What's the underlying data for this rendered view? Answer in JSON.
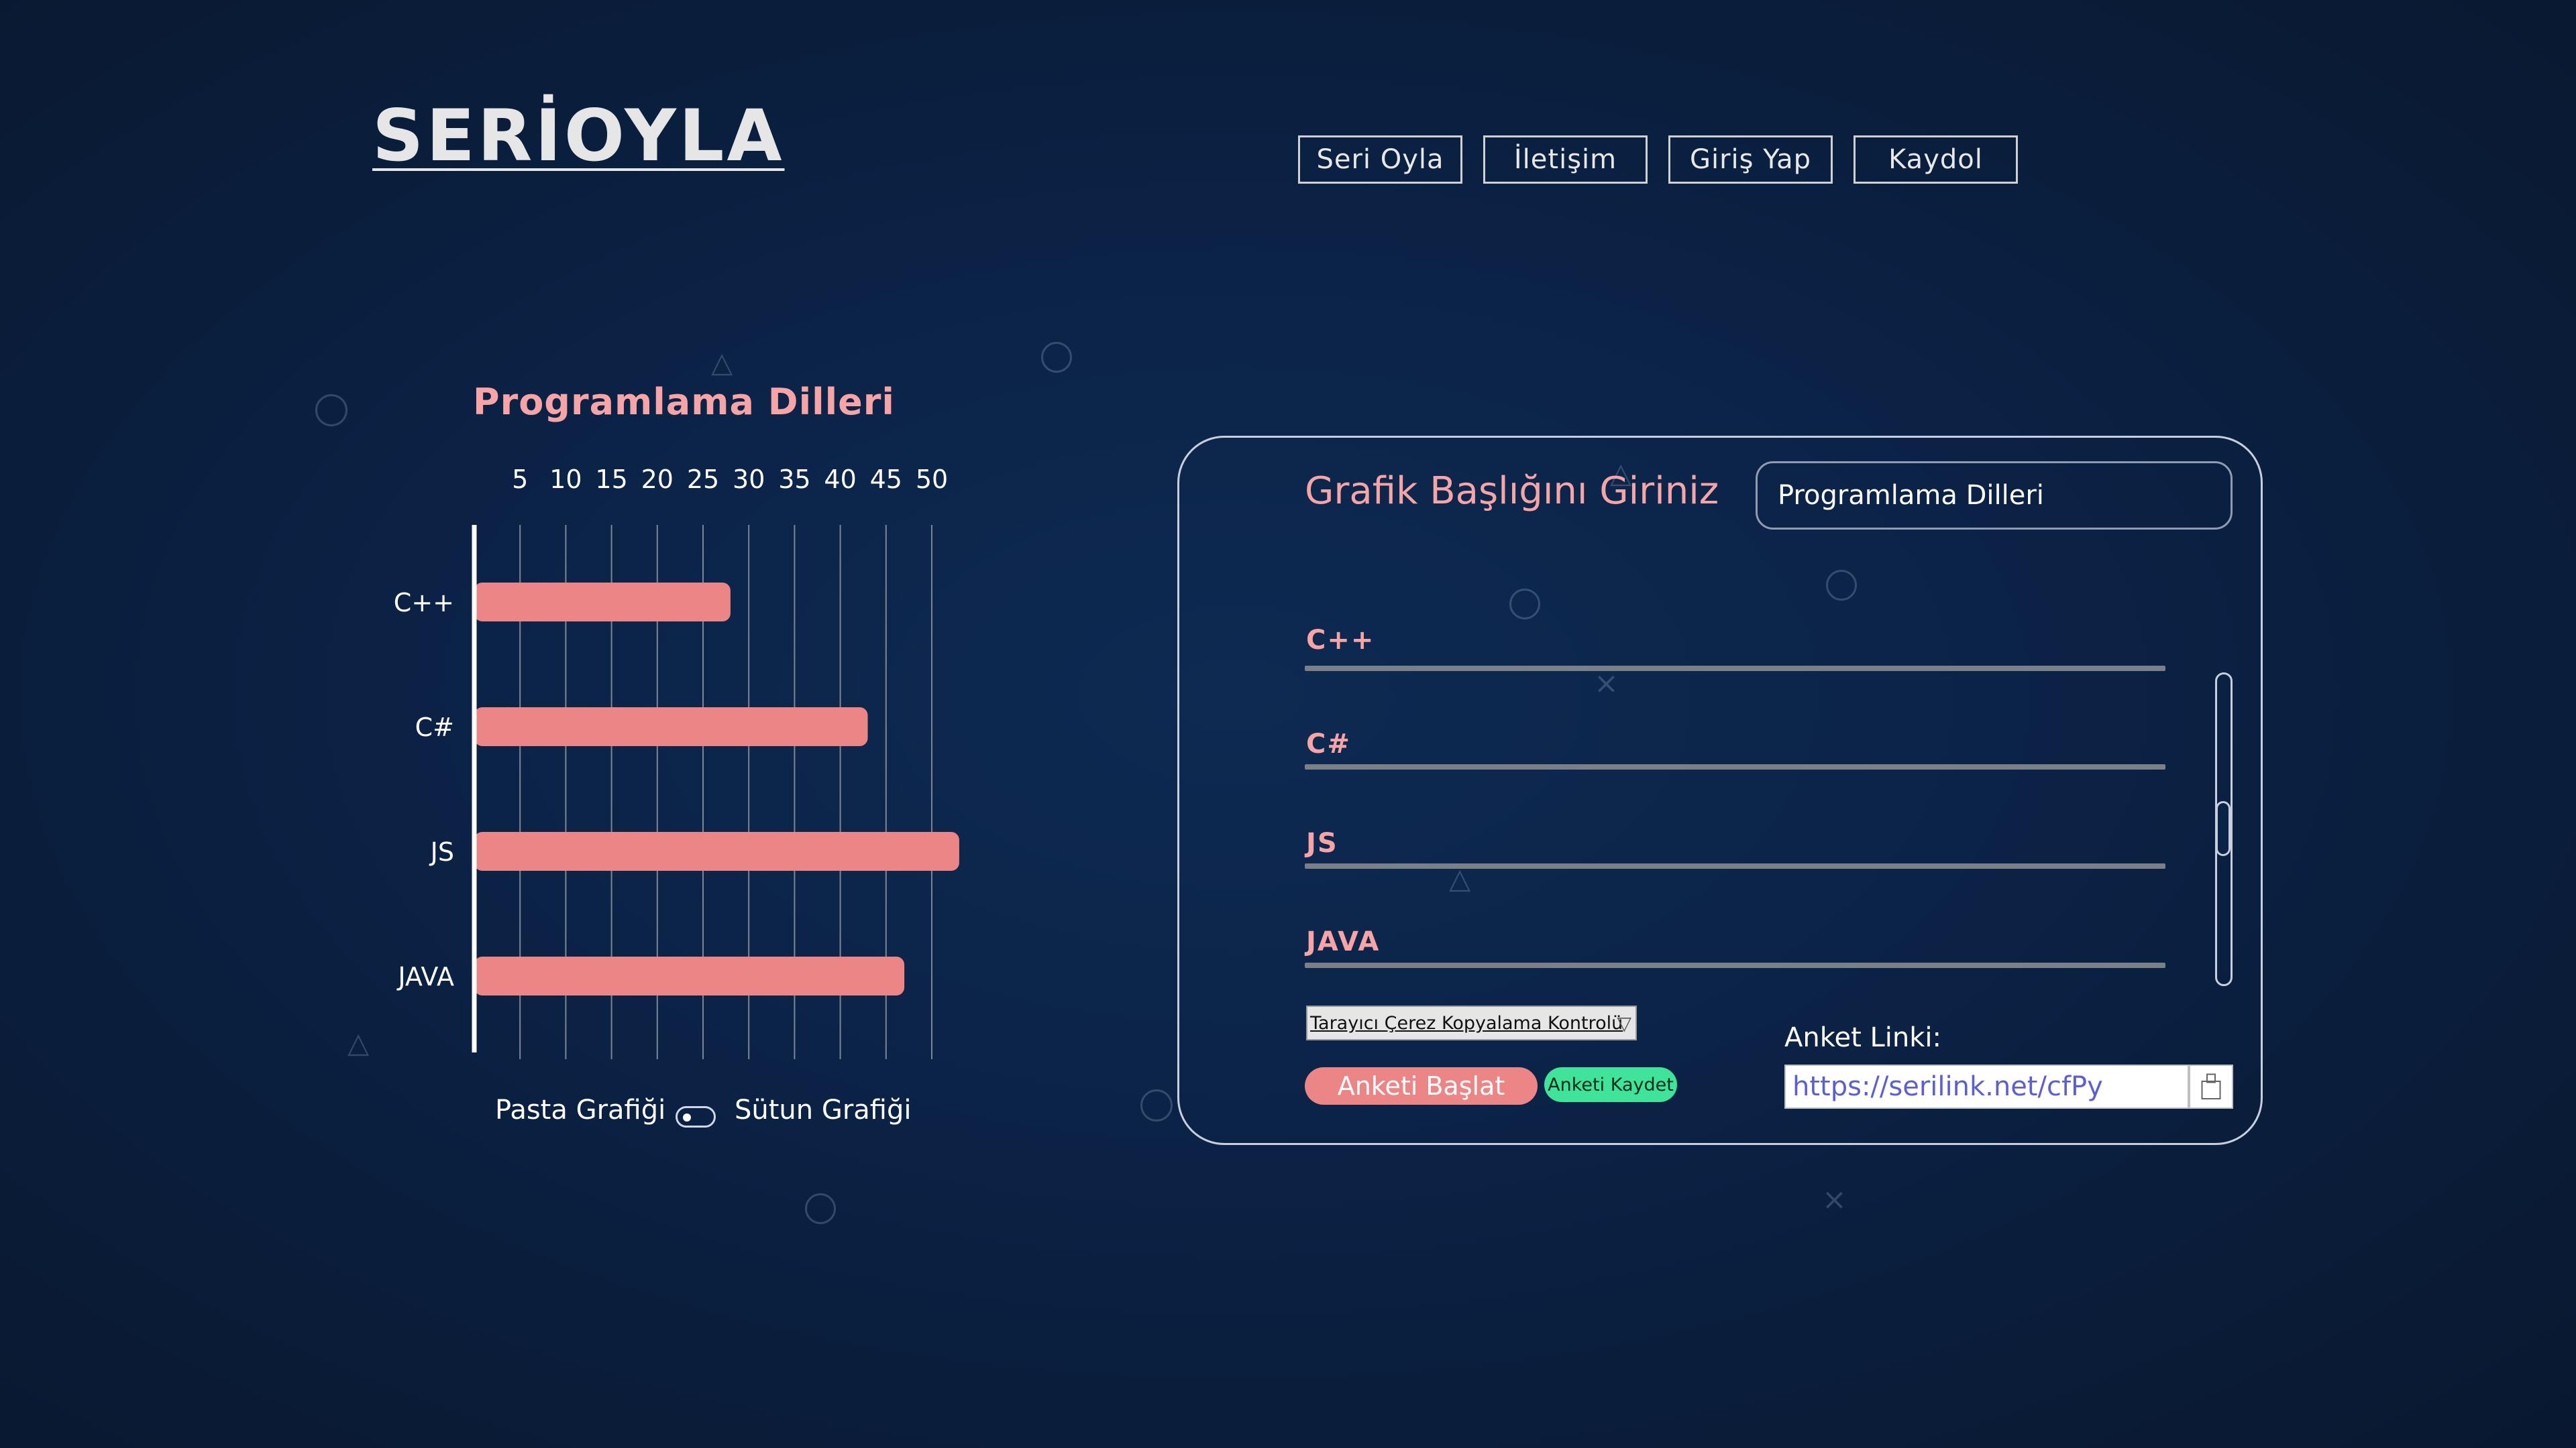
{
  "logo": {
    "text": "SERİOYLA"
  },
  "nav": {
    "items": [
      {
        "label": "Seri Oyla"
      },
      {
        "label": "İletişim"
      },
      {
        "label": "Giriş Yap"
      },
      {
        "label": "Kaydol"
      }
    ]
  },
  "chart": {
    "title": "Programlama Dilleri",
    "toggle_left_label": "Pasta Grafiği",
    "toggle_right_label": "Sütun Grafiği"
  },
  "chart_data": {
    "type": "bar",
    "orientation": "horizontal",
    "title": "Programlama Dilleri",
    "categories": [
      "C++",
      "C#",
      "JS",
      "JAVA"
    ],
    "values": [
      28,
      43,
      53,
      47
    ],
    "tick_labels": [
      "5",
      "10",
      "15",
      "20",
      "25",
      "30",
      "35",
      "40",
      "45",
      "50"
    ],
    "ticks": [
      5,
      10,
      15,
      20,
      25,
      30,
      35,
      40,
      45,
      50
    ],
    "xlim": [
      0,
      53
    ],
    "grid": true,
    "bar_color": "#ec8585"
  },
  "form": {
    "title_label": "Grafik Başlığını Giriniz",
    "title_value": "Programlama Dilleri",
    "options": [
      {
        "label": "C++"
      },
      {
        "label": "C#"
      },
      {
        "label": "JS"
      },
      {
        "label": "JAVA"
      }
    ],
    "select_value": "Tarayıcı Çerez Kopyalama Kontrolü",
    "start_label": "Anketi Başlat",
    "save_label": "Anketi Kaydet",
    "link_label": "Anket Linki:",
    "link_value": "https://serilink.net/cfPy"
  },
  "colors": {
    "accent_pink": "#f6a4a6",
    "bar": "#ec8585",
    "save_green": "#3fe39a",
    "link_text": "#5c5fd4"
  },
  "icons": {
    "copy": "copy-icon",
    "dropdown": "chevron-down-icon"
  }
}
